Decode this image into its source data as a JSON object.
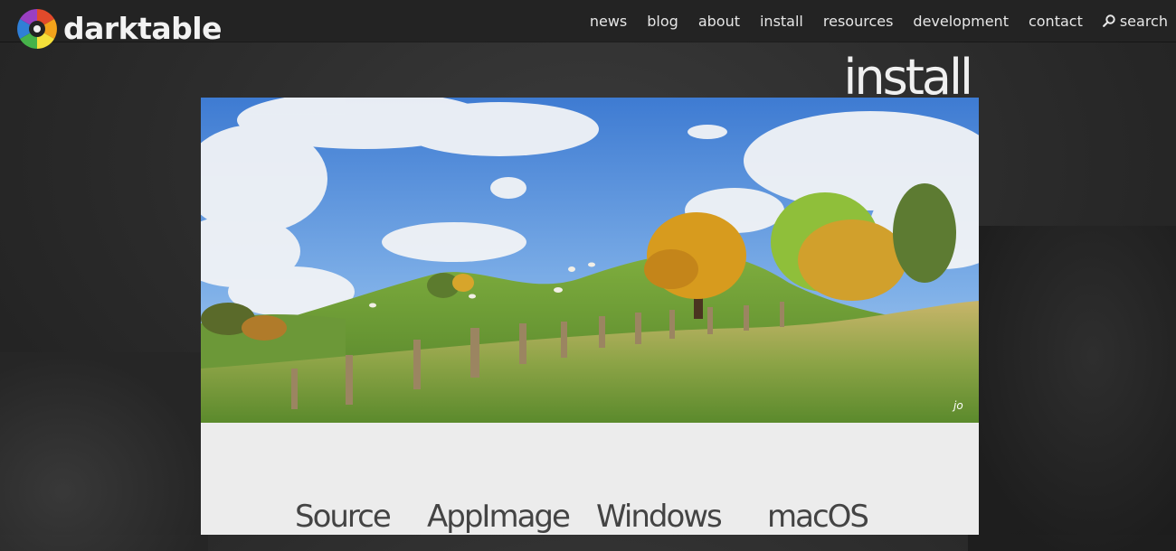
{
  "header": {
    "brand": "darktable",
    "nav": [
      {
        "label": "news"
      },
      {
        "label": "blog"
      },
      {
        "label": "about"
      },
      {
        "label": "install"
      },
      {
        "label": "resources"
      },
      {
        "label": "development"
      },
      {
        "label": "contact"
      }
    ],
    "search_label": "search"
  },
  "page": {
    "title": "install",
    "hero_credit": "jo"
  },
  "install_options": [
    {
      "label": "Source"
    },
    {
      "label": "AppImage"
    },
    {
      "label": "Windows"
    },
    {
      "label": "macOS"
    }
  ],
  "colors": {
    "topbar": "#232323",
    "panel": "#ececec",
    "tab_text": "#444444"
  },
  "icons": {
    "logo": "darktable-aperture-logo",
    "search": "search-icon"
  }
}
